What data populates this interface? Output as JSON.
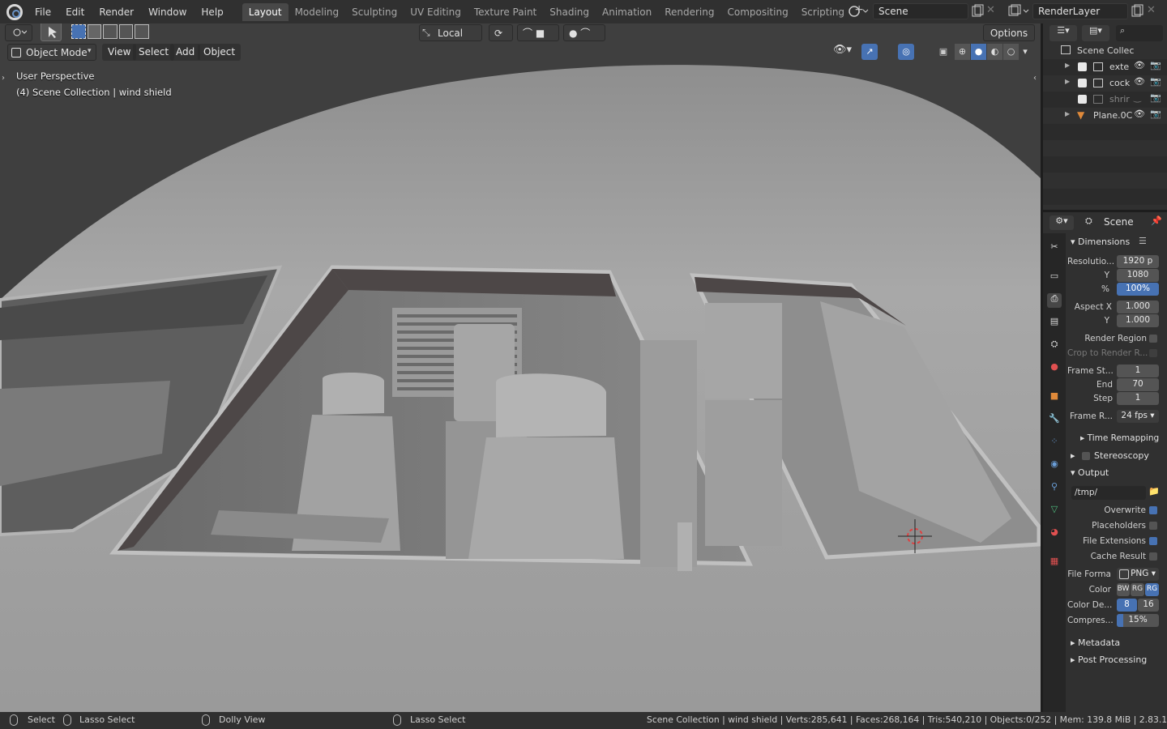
{
  "menus": [
    "File",
    "Edit",
    "Render",
    "Window",
    "Help"
  ],
  "workspaces": [
    "Layout",
    "Modeling",
    "Sculpting",
    "UV Editing",
    "Texture Paint",
    "Shading",
    "Animation",
    "Rendering",
    "Compositing",
    "Scripting"
  ],
  "active_workspace": "Layout",
  "scene_name": "Scene",
  "render_layer": "RenderLayer",
  "toolbar": {
    "transform_orientation": "Local",
    "options_label": "Options"
  },
  "viewport": {
    "mode": "Object Mode",
    "menus": [
      "View",
      "Select",
      "Add",
      "Object"
    ],
    "overlay_title": "User Perspective",
    "overlay_subtitle": "(4) Scene Collection | wind shield"
  },
  "outliner": {
    "root": "Scene Collec",
    "items": [
      {
        "label": "exte",
        "checked": true,
        "visible": true
      },
      {
        "label": "cock",
        "checked": true,
        "visible": true
      },
      {
        "label": "shrir",
        "checked": true,
        "visible": false
      },
      {
        "label": "Plane.0C",
        "checked": false,
        "visible": true
      }
    ]
  },
  "properties": {
    "context": "Scene",
    "dimensions_label": "Dimensions",
    "resolution_label": "Resolutio...",
    "res_x": "1920 p",
    "y_label": "Y",
    "res_y": "1080",
    "pct_label": "%",
    "res_pct": "100%",
    "aspect_x_label": "Aspect X",
    "aspect_x": "1.000",
    "aspect_y_label": "Y",
    "aspect_y": "1.000",
    "render_region": "Render Region",
    "crop": "Crop to Render R...",
    "frame_start_label": "Frame St...",
    "frame_start": "1",
    "end_label": "End",
    "frame_end": "70",
    "step_label": "Step",
    "frame_step": "1",
    "frame_rate_label": "Frame R...",
    "frame_rate": "24 fps",
    "time_remapping": "Time Remapping",
    "stereoscopy": "Stereoscopy",
    "output_label": "Output",
    "output_path": "/tmp/",
    "overwrite": "Overwrite",
    "placeholders": "Placeholders",
    "file_extensions": "File Extensions",
    "cache_result": "Cache Result",
    "file_format_label": "File Forma",
    "file_format": "PNG",
    "color_label": "Color",
    "color_opts": [
      "BW",
      "RG",
      "RG"
    ],
    "color_depth_label": "Color De...",
    "depth_opts": [
      "8",
      "16"
    ],
    "compression_label": "Compres...",
    "compression": "15%",
    "compression_fraction": 0.15,
    "metadata": "Metadata",
    "post_processing": "Post Processing"
  },
  "status": {
    "select": "Select",
    "lasso1": "Lasso Select",
    "dolly": "Dolly View",
    "lasso2": "Lasso Select",
    "stats": "Scene Collection | wind shield | Verts:285,641 | Faces:268,164 | Tris:540,210 | Objects:0/252 | Mem: 139.8 MiB | 2.83.1"
  }
}
